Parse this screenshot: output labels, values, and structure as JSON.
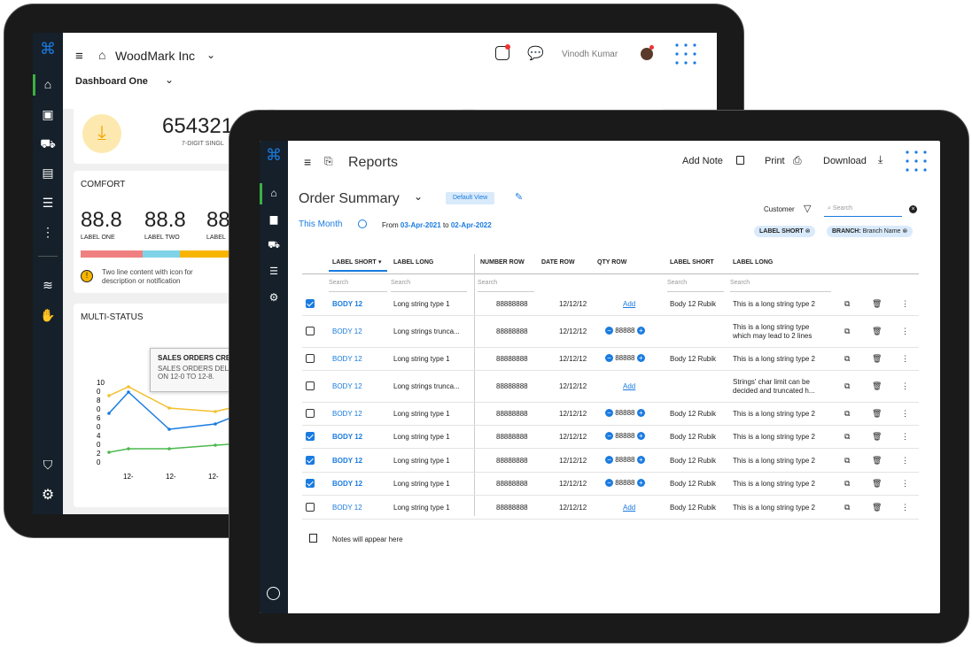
{
  "back": {
    "company": "WoodMark Inc",
    "dashboard": "Dashboard One",
    "user": "Vinodh Kumar",
    "kpi_value": "654321",
    "kpi_label": "7-DIGIT SINGL",
    "comfort_title": "COMFORT",
    "comfort_values": [
      {
        "value": "88.8",
        "label": "LABEL ONE"
      },
      {
        "value": "88.8",
        "label": "LABEL TWO"
      },
      {
        "value": "88",
        "label": "LABEL"
      }
    ],
    "notification": "Two line content with icon for description or notification",
    "multi_title": "MULTI-STATUS",
    "tooltip_title": "SALES ORDERS CRE",
    "tooltip_text": "SALES ORDERS DELI ON 12-0 TO 12-8.",
    "y_ticks": [
      "10",
      "0",
      "8",
      "0",
      "6",
      "0",
      "4",
      "0",
      "2",
      "0"
    ],
    "x_ticks": [
      "12-",
      "12-",
      "12-"
    ],
    "colors": {
      "accent": "#1a7be0",
      "bar1": "#f08080",
      "bar2": "#7fd3e6",
      "bar3": "#f7b500",
      "line_blue": "#1a7be0",
      "line_yellow": "#f2c030",
      "line_green": "#4cb84c"
    }
  },
  "front": {
    "title": "Reports",
    "add_note": "Add Note",
    "print": "Print",
    "download": "Download",
    "summary_title": "Order Summary",
    "default_view": "Default View",
    "this_month": "This Month",
    "from_label": "From",
    "from_date": "03-Apr-2021",
    "to_label": "to",
    "to_date": "02-Apr-2022",
    "customer_label": "Customer",
    "search_placeholder": "Search",
    "chip1": "LABEL SHORT",
    "chip2_key": "BRANCH:",
    "chip2_val": "Branch Name",
    "columns": [
      "LABEL SHORT",
      "LABEL LONG",
      "NUMBER ROW",
      "DATE ROW",
      "QTY ROW",
      "LABEL SHORT",
      "LABEL LONG"
    ],
    "add_label": "Add",
    "notes": "Notes will appear here",
    "rows": [
      {
        "checked": true,
        "short": "BODY 12",
        "long": "Long string type 1",
        "num": "88888888",
        "date": "12/12/12",
        "qty": "",
        "add": true,
        "short2": "Body 12 Rubik",
        "long2": "This is a long string type 2"
      },
      {
        "checked": false,
        "short": "BODY 12",
        "long": "Long strings trunca...",
        "num": "88888888",
        "date": "12/12/12",
        "qty": "88888",
        "add": false,
        "short2": "",
        "long2": "This is a long string type which may lead to 2 lines"
      },
      {
        "checked": false,
        "short": "BODY 12",
        "long": "Long string type 1",
        "num": "88888888",
        "date": "12/12/12",
        "qty": "88888",
        "add": false,
        "short2": "Body 12 Rubik",
        "long2": "This is a long string type 2"
      },
      {
        "checked": false,
        "short": "BODY 12",
        "long": "Long strings trunca...",
        "num": "88888888",
        "date": "12/12/12",
        "qty": "",
        "add": true,
        "short2": "",
        "long2": "Strings' char limit can be decided and truncated h..."
      },
      {
        "checked": false,
        "short": "BODY 12",
        "long": "Long string type 1",
        "num": "88888888",
        "date": "12/12/12",
        "qty": "88888",
        "add": false,
        "short2": "Body 12 Rubik",
        "long2": "This is a long string type 2"
      },
      {
        "checked": true,
        "short": "BODY 12",
        "long": "Long string type 1",
        "num": "88888888",
        "date": "12/12/12",
        "qty": "88888",
        "add": false,
        "short2": "Body 12 Rubik",
        "long2": "This is a long string type 2"
      },
      {
        "checked": true,
        "short": "BODY 12",
        "long": "Long string type 1",
        "num": "88888888",
        "date": "12/12/12",
        "qty": "88888",
        "add": false,
        "short2": "Body 12 Rubik",
        "long2": "This is a long string type 2"
      },
      {
        "checked": true,
        "short": "BODY 12",
        "long": "Long string type 1",
        "num": "88888888",
        "date": "12/12/12",
        "qty": "88888",
        "add": false,
        "short2": "Body 12 Rubik",
        "long2": "This is a long string type 2"
      },
      {
        "checked": false,
        "short": "BODY 12",
        "long": "Long string type 1",
        "num": "88888888",
        "date": "12/12/12",
        "qty": "",
        "add": true,
        "short2": "Body 12 Rubik",
        "long2": "This is a long string type 2"
      }
    ]
  }
}
